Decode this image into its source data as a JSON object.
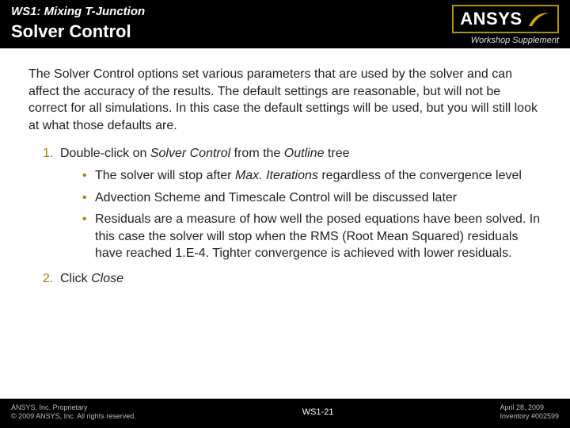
{
  "header": {
    "subtitle": "WS1: Mixing T-Junction",
    "title": "Solver Control",
    "logo_text": "ANSYS",
    "workshop_supplement": "Workshop Supplement"
  },
  "body": {
    "intro": "The Solver Control options set various parameters that are used by the solver and can affect the accuracy of the results.  The default settings are reasonable, but will not be correct for all simulations.  In this case the default settings will be used, but you will still look at what those defaults are.",
    "steps": [
      {
        "num": "1.",
        "text_pre": "Double-click on ",
        "em1": "Solver Control",
        "text_mid": " from the ",
        "em2": "Outline",
        "text_post": " tree",
        "bullets": [
          {
            "pre": "The solver will stop after ",
            "em": "Max. Iterations",
            "post": " regardless of the convergence level"
          },
          {
            "pre": "Advection Scheme and Timescale Control will be discussed later",
            "em": "",
            "post": ""
          },
          {
            "pre": "Residuals are a measure of how well the posed equations have been solved.  In this case the solver will stop when the RMS (Root Mean Squared) residuals have reached 1.E-4.  Tighter convergence is achieved with lower residuals.",
            "em": "",
            "post": ""
          }
        ]
      },
      {
        "num": "2.",
        "text_pre": "Click ",
        "em1": "Close",
        "text_mid": "",
        "em2": "",
        "text_post": ""
      }
    ]
  },
  "footer": {
    "left1": "ANSYS, Inc. Proprietary",
    "left2": "© 2009 ANSYS, Inc.  All rights reserved.",
    "center": "WS1-21",
    "right1": "April 28, 2009",
    "right2": "Inventory #002599"
  }
}
